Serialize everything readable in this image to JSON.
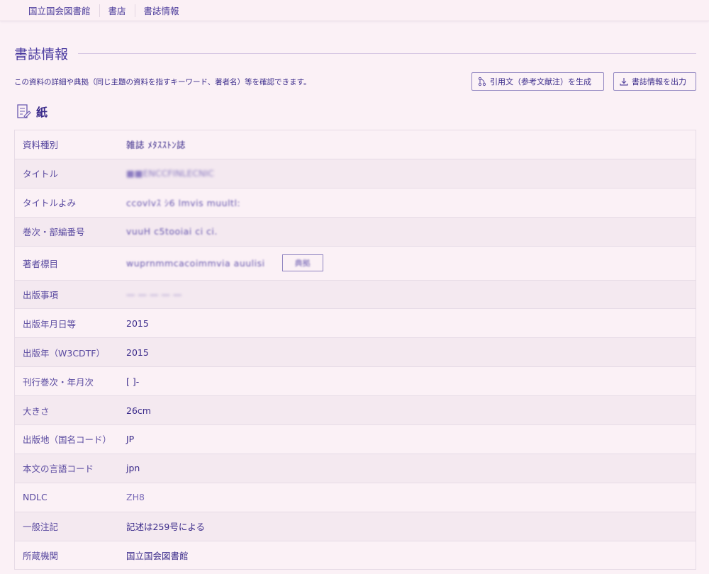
{
  "breadcrumb": [
    "国立国会図書館",
    "書店",
    "書誌情報"
  ],
  "page": {
    "title": "書誌情報",
    "description": "この資料の詳細や典拠（同じ主題の資料を指すキーワード、著者名）等を確認できます。",
    "cite_button": "引用文（参考文献注）を生成",
    "export_button": "書誌情報を出力",
    "format_label": "紙"
  },
  "rows": [
    {
      "label": "資料種別",
      "value": "雑誌 ﾒﾀｽｽﾄﾝ誌"
    },
    {
      "label": "タイトル",
      "value": "■■ENCCFINLECNIC"
    },
    {
      "label": "タイトルよみ",
      "value": "ccovlvｽ ｼ6 lmvis muultl:"
    },
    {
      "label": "巻次・部編番号",
      "value": "vuuH  c5tooiai ci ci."
    },
    {
      "label": "著者標目",
      "value": "wuprnmmcacoimmvia auulisi",
      "button": "典拠"
    },
    {
      "label": "出版事項",
      "value": "—  —  — — —"
    },
    {
      "label": "出版年月日等",
      "value": "2015"
    },
    {
      "label": "出版年（W3CDTF）",
      "value": "2015"
    },
    {
      "label": "刊行巻次・年月次",
      "value": "[ ]-"
    },
    {
      "label": "大きさ",
      "value": "26cm"
    },
    {
      "label": "出版地（国名コード）",
      "value": "JP"
    },
    {
      "label": "本文の言語コード",
      "value": "jpn"
    },
    {
      "label": "NDLC",
      "value": "ZH8"
    },
    {
      "label": "一般注記",
      "value": "記述は259号による"
    },
    {
      "label": "所蔵機関",
      "value": "国立国会図書館"
    }
  ]
}
